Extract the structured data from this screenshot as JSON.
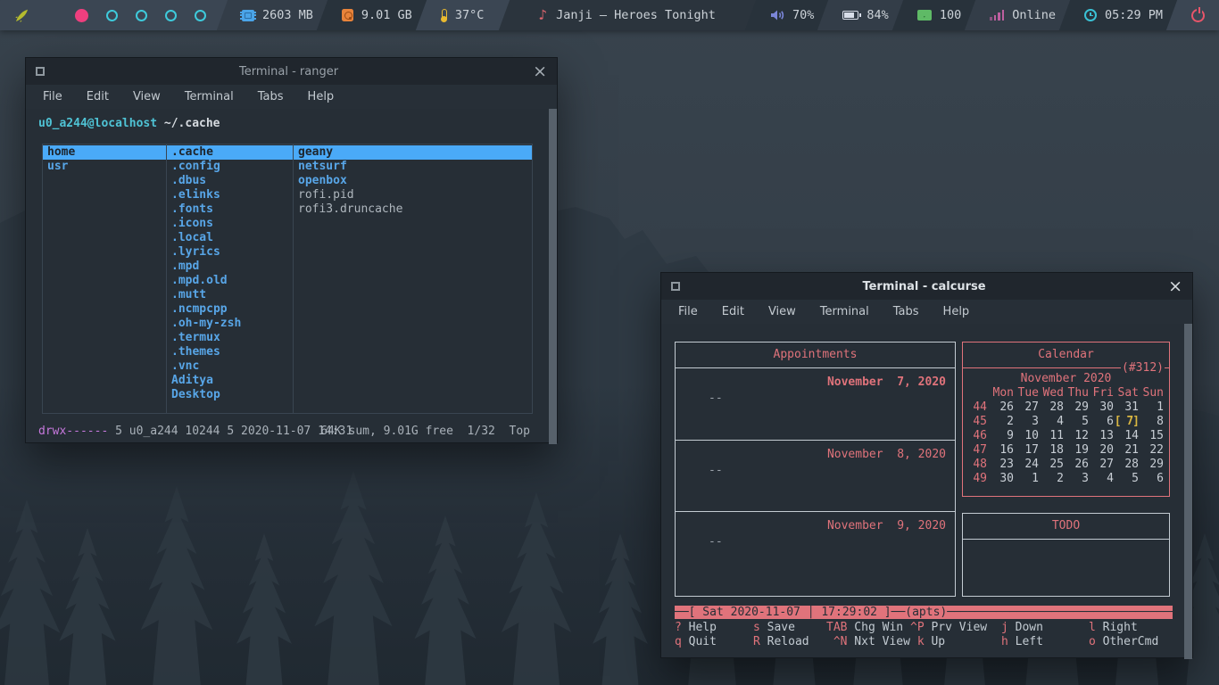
{
  "colors": {
    "accent_blue": "#4aaaf8",
    "dir_blue": "#58a6e8",
    "salmon": "#e0737b",
    "cyan_prompt": "#4fc3d5",
    "magenta_perms": "#c678dd",
    "today_yellow": "#d9b642",
    "workspace_active_pink": "#ee3f7e",
    "workspace_inactive_cyan": "#3ecadb",
    "mail_green": "#5fba66",
    "disk_orange": "#e8833a",
    "temp_yellow": "#e8b930",
    "ram_blue": "#4aa4e8",
    "volume_purple": "#7b86d8",
    "network_pink": "#bd5f9f",
    "power_red": "#e8556a"
  },
  "panel": {
    "workspaces": {
      "count": 5,
      "active_index": 0
    },
    "memory": "2603 MB",
    "disk": "9.01 GB",
    "temperature": "37°C",
    "now_playing": "Janji – Heroes Tonight",
    "volume": "70%",
    "battery": "84%",
    "mail_count": "100",
    "network": "Online",
    "clock": "05:29 PM"
  },
  "ranger": {
    "window_title": "Terminal - ranger",
    "menu": [
      "File",
      "Edit",
      "View",
      "Terminal",
      "Tabs",
      "Help"
    ],
    "prompt_user": "u0_a244@localhost",
    "prompt_path": "~/.cache",
    "parent_column": [
      {
        "name": "home",
        "type": "dir",
        "selected": true
      },
      {
        "name": "usr",
        "type": "dir",
        "selected": false
      }
    ],
    "current_column": [
      {
        "name": ".cache",
        "type": "dir",
        "selected": true
      },
      {
        "name": ".config",
        "type": "dir",
        "selected": false
      },
      {
        "name": ".dbus",
        "type": "dir",
        "selected": false
      },
      {
        "name": ".elinks",
        "type": "dir",
        "selected": false
      },
      {
        "name": ".fonts",
        "type": "dir",
        "selected": false
      },
      {
        "name": ".icons",
        "type": "dir",
        "selected": false
      },
      {
        "name": ".local",
        "type": "dir",
        "selected": false
      },
      {
        "name": ".lyrics",
        "type": "dir",
        "selected": false
      },
      {
        "name": ".mpd",
        "type": "dir",
        "selected": false
      },
      {
        "name": ".mpd.old",
        "type": "dir",
        "selected": false
      },
      {
        "name": ".mutt",
        "type": "dir",
        "selected": false
      },
      {
        "name": ".ncmpcpp",
        "type": "dir",
        "selected": false
      },
      {
        "name": ".oh-my-zsh",
        "type": "dir",
        "selected": false
      },
      {
        "name": ".termux",
        "type": "dir",
        "selected": false
      },
      {
        "name": ".themes",
        "type": "dir",
        "selected": false
      },
      {
        "name": ".vnc",
        "type": "dir",
        "selected": false
      },
      {
        "name": "Aditya",
        "type": "dir",
        "selected": false
      },
      {
        "name": "Desktop",
        "type": "dir",
        "selected": false
      }
    ],
    "preview_column": [
      {
        "name": "geany",
        "type": "dir",
        "selected": true
      },
      {
        "name": "netsurf",
        "type": "dir",
        "selected": false
      },
      {
        "name": "openbox",
        "type": "dir",
        "selected": false
      },
      {
        "name": "rofi.pid",
        "type": "file",
        "selected": false
      },
      {
        "name": "rofi3.druncache",
        "type": "file",
        "selected": false
      }
    ],
    "status_perms": "drwx------",
    "status_info": " 5 u0_a244 10244 5 2020-11-07 14:31",
    "status_right": "64K sum, 9.01G free  1/32  Top"
  },
  "calcurse": {
    "window_title": "Terminal - calcurse",
    "menu": [
      "File",
      "Edit",
      "View",
      "Terminal",
      "Tabs",
      "Help"
    ],
    "appointments": {
      "title": "Appointments",
      "entries": [
        {
          "date": "November  7, 2020",
          "today": true,
          "item": "--"
        },
        {
          "date": "November  8, 2020",
          "today": false,
          "item": "--"
        },
        {
          "date": "November  9, 2020",
          "today": false,
          "item": "--"
        }
      ]
    },
    "calendar": {
      "title": "Calendar",
      "counter": "(#312)",
      "month_label": "November 2020",
      "weekdays": [
        "Mon",
        "Tue",
        "Wed",
        "Thu",
        "Fri",
        "Sat",
        "Sun"
      ],
      "weeks": [
        {
          "week": "44",
          "days": [
            "26",
            "27",
            "28",
            "29",
            "30",
            "31",
            "1"
          ]
        },
        {
          "week": "45",
          "days": [
            "2",
            "3",
            "4",
            "5",
            "6",
            "7",
            "8"
          ],
          "today_index": 5
        },
        {
          "week": "46",
          "days": [
            "9",
            "10",
            "11",
            "12",
            "13",
            "14",
            "15"
          ]
        },
        {
          "week": "47",
          "days": [
            "16",
            "17",
            "18",
            "19",
            "20",
            "21",
            "22"
          ]
        },
        {
          "week": "48",
          "days": [
            "23",
            "24",
            "25",
            "26",
            "27",
            "28",
            "29"
          ]
        },
        {
          "week": "49",
          "days": [
            "30",
            "1",
            "2",
            "3",
            "4",
            "5",
            "6"
          ]
        }
      ]
    },
    "todo": {
      "title": "TODO"
    },
    "status_bar": {
      "date": "Sat 2020-11-07",
      "time": "17:29:02",
      "view": "(apts)"
    },
    "hints": [
      [
        {
          "key": "?",
          "label": "Help"
        },
        {
          "key": "q",
          "label": "Quit"
        }
      ],
      [
        {
          "key": "s",
          "label": "Save"
        },
        {
          "key": "R",
          "label": "Reload"
        }
      ],
      [
        {
          "key": "TAB",
          "label": "Chg Win"
        },
        {
          "key": "^N",
          "label": "Nxt View"
        }
      ],
      [
        {
          "key": "^P",
          "label": "Prv View"
        },
        {
          "key": "k",
          "label": "Up"
        }
      ],
      [
        {
          "key": "j",
          "label": "Down"
        },
        {
          "key": "h",
          "label": "Left"
        }
      ],
      [
        {
          "key": "l",
          "label": "Right"
        },
        {
          "key": "o",
          "label": "OtherCmd"
        }
      ]
    ]
  }
}
